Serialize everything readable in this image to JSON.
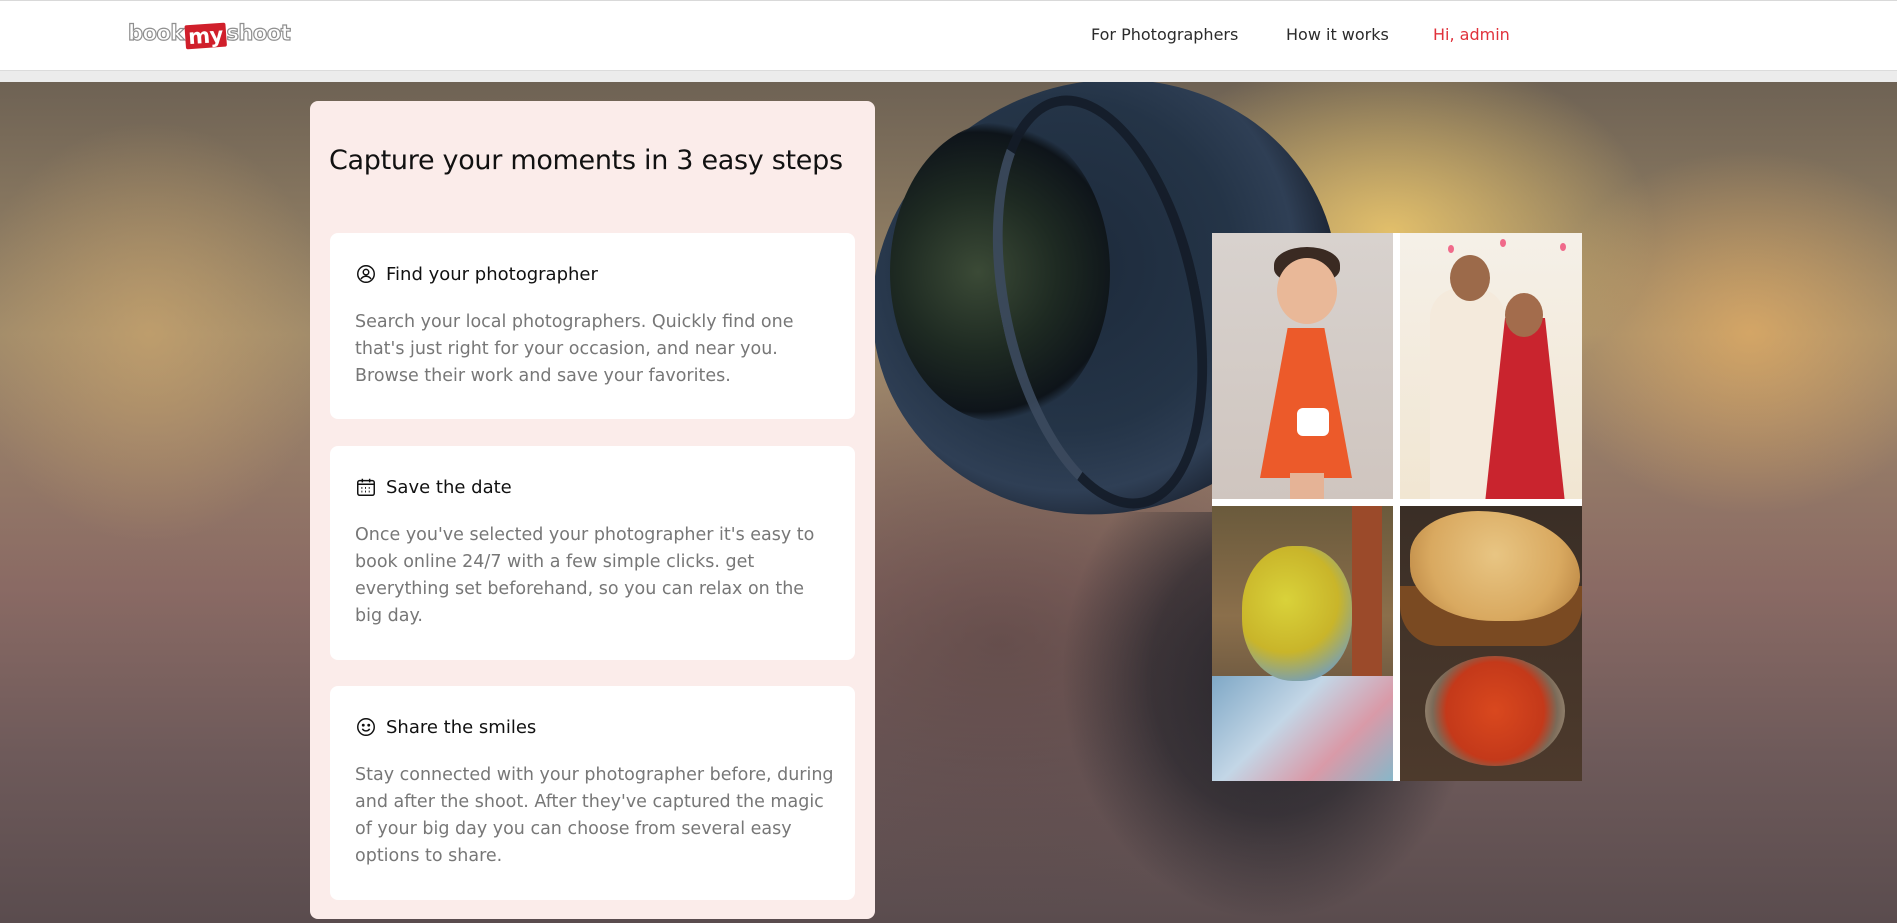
{
  "brand": {
    "logo_part1": "book",
    "logo_part2": "my",
    "logo_part3": "shoot"
  },
  "nav": {
    "links": [
      {
        "label": "For Photographers"
      },
      {
        "label": "How it works"
      },
      {
        "label": "Hi, admin"
      }
    ]
  },
  "colors": {
    "accent": "#e0313b",
    "card_background": "#fbecea",
    "step_background": "#ffffff",
    "muted_text": "#777777"
  },
  "steps_section": {
    "title": "Capture your moments in 3 easy steps",
    "steps": [
      {
        "icon": "search-person-icon",
        "title": "Find your photographer",
        "description": "Search your local photographers. Quickly find one that's just right for your occasion, and near you. Browse their work and save your favorites."
      },
      {
        "icon": "calendar-icon",
        "title": "Save the date",
        "description": "Once you've selected your photographer it's easy to book online 24/7 with a few simple clicks. get everything set beforehand, so you can relax on the big day."
      },
      {
        "icon": "smiley-icon",
        "title": "Share the smiles",
        "description": "Stay connected with your photographer before, during and after the shoot. After they've captured the magic of your big day you can choose from several easy options to share."
      }
    ]
  },
  "gallery": {
    "photos": [
      {
        "subject": "child-portrait-photo"
      },
      {
        "subject": "wedding-couple-photo"
      },
      {
        "subject": "holi-festival-photo"
      },
      {
        "subject": "food-naan-curry-photo"
      }
    ]
  }
}
